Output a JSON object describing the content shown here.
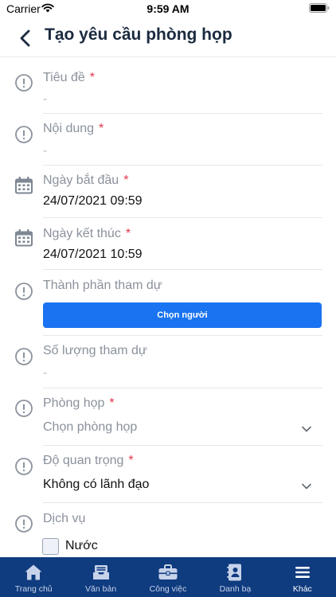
{
  "status_bar": {
    "carrier": "Carrier",
    "time": "9:59 AM"
  },
  "header": {
    "title": "Tạo yêu cầu phòng họp",
    "back_icon": "chevron-left-icon"
  },
  "form": {
    "title": {
      "label": "Tiêu đề",
      "required": "*",
      "value": "-"
    },
    "content": {
      "label": "Nội dung",
      "required": "*",
      "value": "-"
    },
    "start_date": {
      "label": "Ngày bắt đầu",
      "required": "*",
      "value": "24/07/2021 09:59"
    },
    "end_date": {
      "label": "Ngày kết thúc",
      "required": "*",
      "value": "24/07/2021 10:59"
    },
    "participants": {
      "label": "Thành phần tham dự",
      "button": "Chọn người"
    },
    "participant_count": {
      "label": "Số lượng tham dự",
      "value": "-"
    },
    "room": {
      "label": "Phòng họp",
      "required": "*",
      "placeholder": "Chọn phòng họp"
    },
    "importance": {
      "label": "Độ quan trọng",
      "required": "*",
      "value": "Không có lãnh đạo"
    },
    "services": {
      "label": "Dịch vụ",
      "options": [
        {
          "label": "Nước",
          "checked": false
        }
      ]
    }
  },
  "tabs": [
    {
      "label": "Trang chủ",
      "icon": "home-icon",
      "active": false
    },
    {
      "label": "Văn bản",
      "icon": "inbox-icon",
      "active": false
    },
    {
      "label": "Công việc",
      "icon": "briefcase-icon",
      "active": false
    },
    {
      "label": "Danh bạ",
      "icon": "contacts-icon",
      "active": false
    },
    {
      "label": "Khác",
      "icon": "menu-icon",
      "active": true
    }
  ],
  "colors": {
    "primary": "#1a73f0",
    "tab_bar": "#0f3b7f",
    "required": "#e3344c",
    "label": "#8a919c"
  }
}
